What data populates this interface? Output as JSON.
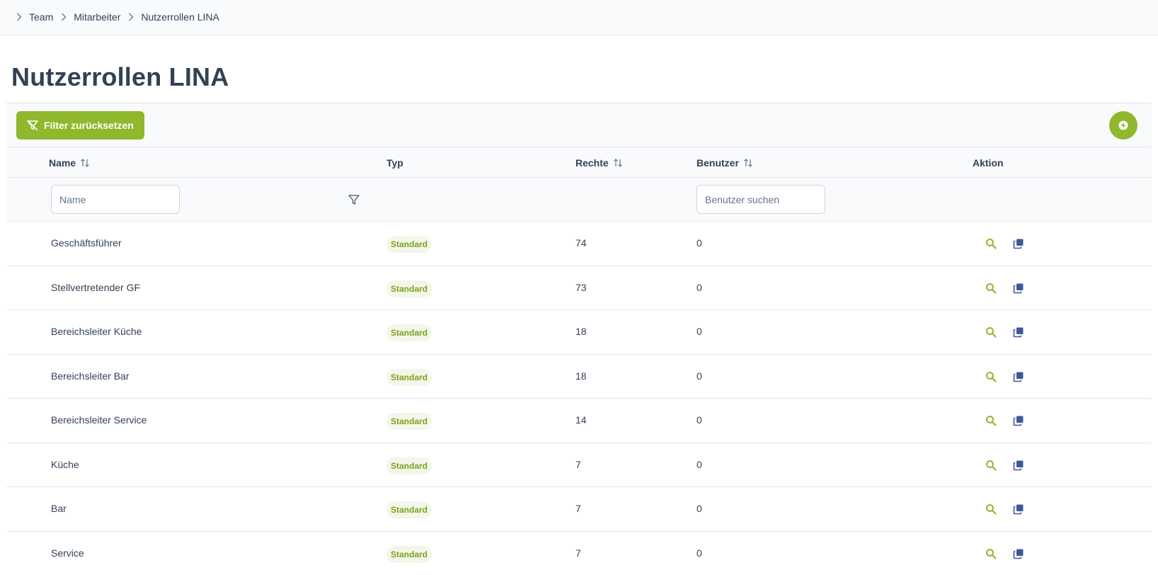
{
  "breadcrumb": [
    "Team",
    "Mitarbeiter",
    "Nutzerrollen LINA"
  ],
  "page_title": "Nutzerrollen LINA",
  "toolbar": {
    "reset_filter_label": "Filter zurücksetzen",
    "add_icon": "plus-circle-icon"
  },
  "columns": {
    "name": "Name",
    "type": "Typ",
    "rights": "Rechte",
    "users": "Benutzer",
    "action": "Aktion"
  },
  "filters": {
    "name_placeholder": "Name",
    "users_placeholder": "Benutzer suchen"
  },
  "colors": {
    "accent": "#8fb82c",
    "badge_text": "#7aa31f",
    "badge_bg": "#f3f6e8",
    "copy_icon": "#3b5998"
  },
  "rows": [
    {
      "name": "Geschäftsführer",
      "type": "Standard",
      "rights": "74",
      "users": "0"
    },
    {
      "name": "Stellvertretender GF",
      "type": "Standard",
      "rights": "73",
      "users": "0"
    },
    {
      "name": "Bereichsleiter Küche",
      "type": "Standard",
      "rights": "18",
      "users": "0"
    },
    {
      "name": "Bereichsleiter Bar",
      "type": "Standard",
      "rights": "18",
      "users": "0"
    },
    {
      "name": "Bereichsleiter Service",
      "type": "Standard",
      "rights": "14",
      "users": "0"
    },
    {
      "name": "Küche",
      "type": "Standard",
      "rights": "7",
      "users": "0"
    },
    {
      "name": "Bar",
      "type": "Standard",
      "rights": "7",
      "users": "0"
    },
    {
      "name": "Service",
      "type": "Standard",
      "rights": "7",
      "users": "0"
    }
  ]
}
